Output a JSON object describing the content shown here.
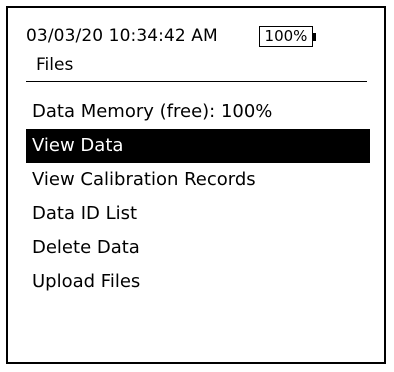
{
  "status_bar": {
    "datetime": "03/03/20 10:34:42 AM",
    "battery_level": "100%"
  },
  "screen": {
    "title": "Files"
  },
  "menu": {
    "selected_index": 1,
    "items": [
      {
        "label": "Data Memory (free): 100%"
      },
      {
        "label": "View Data"
      },
      {
        "label": "View Calibration Records"
      },
      {
        "label": "Data ID List"
      },
      {
        "label": "Delete Data"
      },
      {
        "label": "Upload Files"
      }
    ]
  },
  "colors": {
    "foreground": "#000000",
    "background": "#ffffff",
    "selection_background": "#000000",
    "selection_text": "#ffffff"
  }
}
